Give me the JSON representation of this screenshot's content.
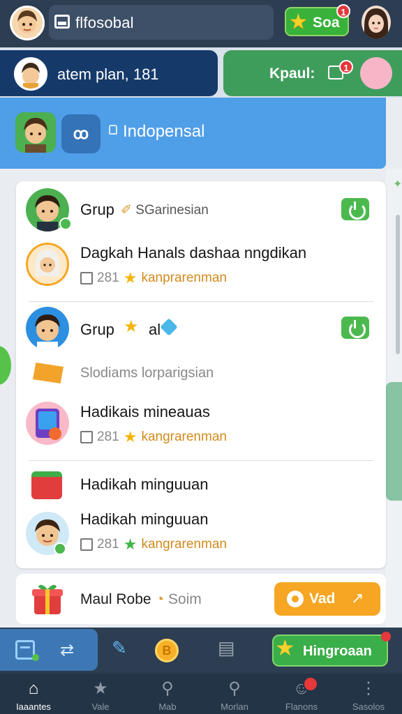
{
  "topbar": {
    "search_text": "flfosobal",
    "soa_label": "Soa",
    "soa_badge": "1"
  },
  "status": {
    "text": "atem plan, 181",
    "kpaul_label": "Kpaul:",
    "kpaul_badge": "1"
  },
  "banner": {
    "group_symbol": "ꝏ",
    "text": "Indopensal"
  },
  "feed": [
    {
      "title": "Grup",
      "sub": "SGarinesian"
    },
    {
      "title": "Dagkah Hanals dashaa nngdikan",
      "meta_num": "281",
      "meta_text": "kanprarenman"
    },
    {
      "title": "Grup",
      "sub": "al"
    },
    {
      "sub": "Slodiams lorparigsian"
    },
    {
      "title": "Hadikais mineauas",
      "meta_num": "281",
      "meta_text": "kangrarenman"
    },
    {
      "title": "Hadikah minguuan"
    },
    {
      "title": "Hadikah minguuan",
      "meta_num": "281",
      "meta_text": "kangrarenman"
    }
  ],
  "promo": {
    "text": "Maul Robe",
    "muted": "Soim",
    "button_label": "Vad"
  },
  "toolbar": {
    "coin_symbol": "B",
    "action_label": "Hingroaan"
  },
  "nav": [
    {
      "label": "Iaaantes",
      "icon": "home-icon"
    },
    {
      "label": "Vale",
      "icon": "star-icon"
    },
    {
      "label": "Mab",
      "icon": "search-icon"
    },
    {
      "label": "Morlan",
      "icon": "search-icon"
    },
    {
      "label": "Flanons",
      "icon": "people-icon"
    },
    {
      "label": "Sasolos",
      "icon": "more-icon"
    }
  ],
  "colors": {
    "topbar": "#2d3e52",
    "banner": "#4f9ee8",
    "accent_green": "#4cb94f",
    "accent_orange": "#f6a623",
    "badge_red": "#e5383b"
  }
}
